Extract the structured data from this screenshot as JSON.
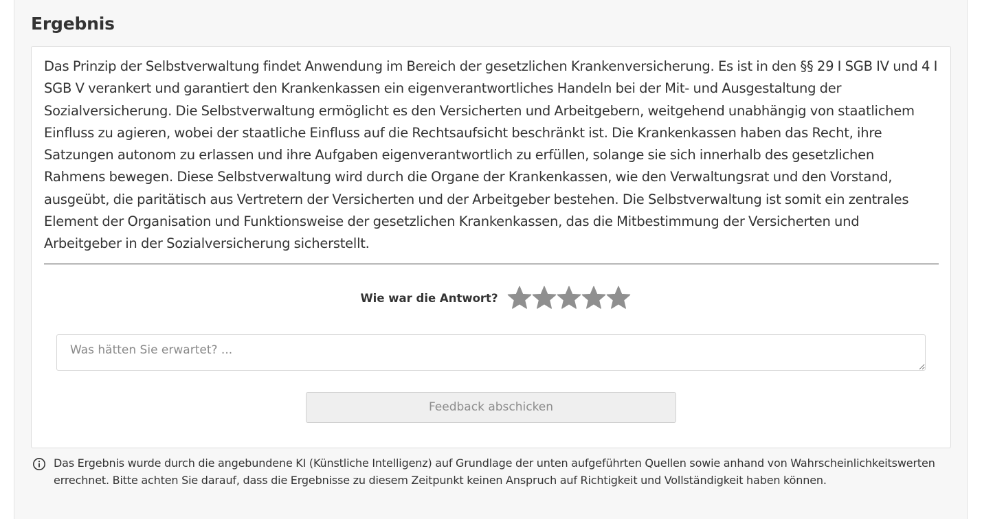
{
  "result": {
    "heading": "Ergebnis",
    "answer_text": "Das Prinzip der Selbstverwaltung findet Anwendung im Bereich der gesetzlichen Krankenversicherung. Es ist in den §§ 29 I SGB IV und 4 I SGB V verankert und garantiert den Krankenkassen ein eigenverantwortliches Handeln bei der Mit- und Ausgestaltung der Sozialversicherung. Die Selbstverwaltung ermöglicht es den Versicherten und Arbeitgebern, weitgehend unabhängig von staatlichem Einfluss zu agieren, wobei der staatliche Einfluss auf die Rechtsaufsicht beschränkt ist. Die Krankenkassen haben das Recht, ihre Satzungen autonom zu erlassen und ihre Aufgaben eigenverantwortlich zu erfüllen, solange sie sich innerhalb des gesetzlichen Rahmens bewegen. Diese Selbstverwaltung wird durch die Organe der Krankenkassen, wie den Verwaltungsrat und den Vorstand, ausgeübt, die paritätisch aus Vertretern der Versicherten und der Arbeitgeber bestehen. Die Selbstverwaltung ist somit ein zentrales Element der Organisation und Funktionsweise der gesetzlichen Krankenkassen, das die Mitbestimmung der Versicherten und Arbeitgeber in der Sozialversicherung sicherstellt."
  },
  "rating": {
    "label": "Wie war die Antwort?",
    "max_stars": 5,
    "selected": 0,
    "star_color": "#8f8f8f"
  },
  "feedback": {
    "placeholder": "Was hätten Sie erwartet? ...",
    "value": "",
    "submit_label": "Feedback abschicken"
  },
  "disclaimer": {
    "icon": "info-icon",
    "text": "Das Ergebnis wurde durch die angebundene KI (Künstliche Intelligenz) auf Grundlage der unten aufgeführten Quellen sowie anhand von Wahrscheinlichkeitswerten errechnet. Bitte achten Sie darauf, dass die Ergebnisse zu diesem Zeitpunkt keinen Anspruch auf Richtigkeit und Vollständigkeit haben können."
  }
}
